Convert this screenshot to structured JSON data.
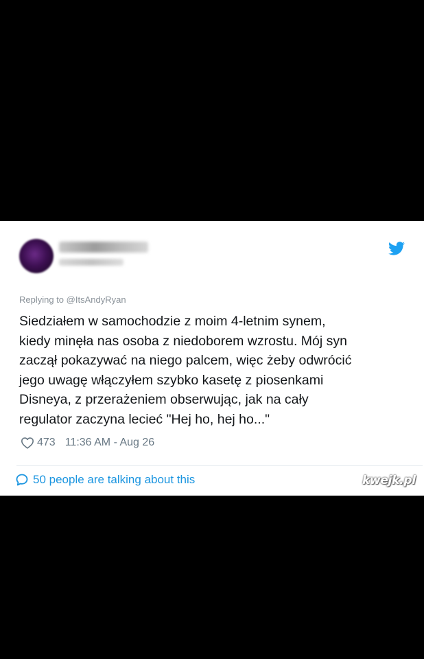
{
  "tweet": {
    "reply_prefix": "Replying to",
    "reply_to": "@ItsAndyRyan",
    "text_lines": [
      "Siedziałem w samochodzie z moim 4-letnim synem,",
      "kiedy minęła nas osoba z niedoborem wzrostu. Mój syn",
      "zaczął pokazywać na niego palcem, więc żeby odwrócić",
      "jego uwagę włączyłem szybko kasetę z piosenkami",
      "Disneya, z przerażeniem obserwując, jak na cały",
      "regulator zaczyna lecieć \"Hej ho, hej ho...\""
    ],
    "likes": "473",
    "time": "11:36 AM - Aug 26",
    "talking": "50 people are talking about this"
  },
  "watermark": "kwejk.pl",
  "icons": {
    "brand": "twitter-bird-icon",
    "like": "heart-icon",
    "reply": "speech-bubble-icon"
  },
  "colors": {
    "background": "#000000",
    "card": "#ffffff",
    "text": "#14171a",
    "muted": "#687884",
    "link": "#1b95e0",
    "twitter_blue": "#1da1f2"
  }
}
